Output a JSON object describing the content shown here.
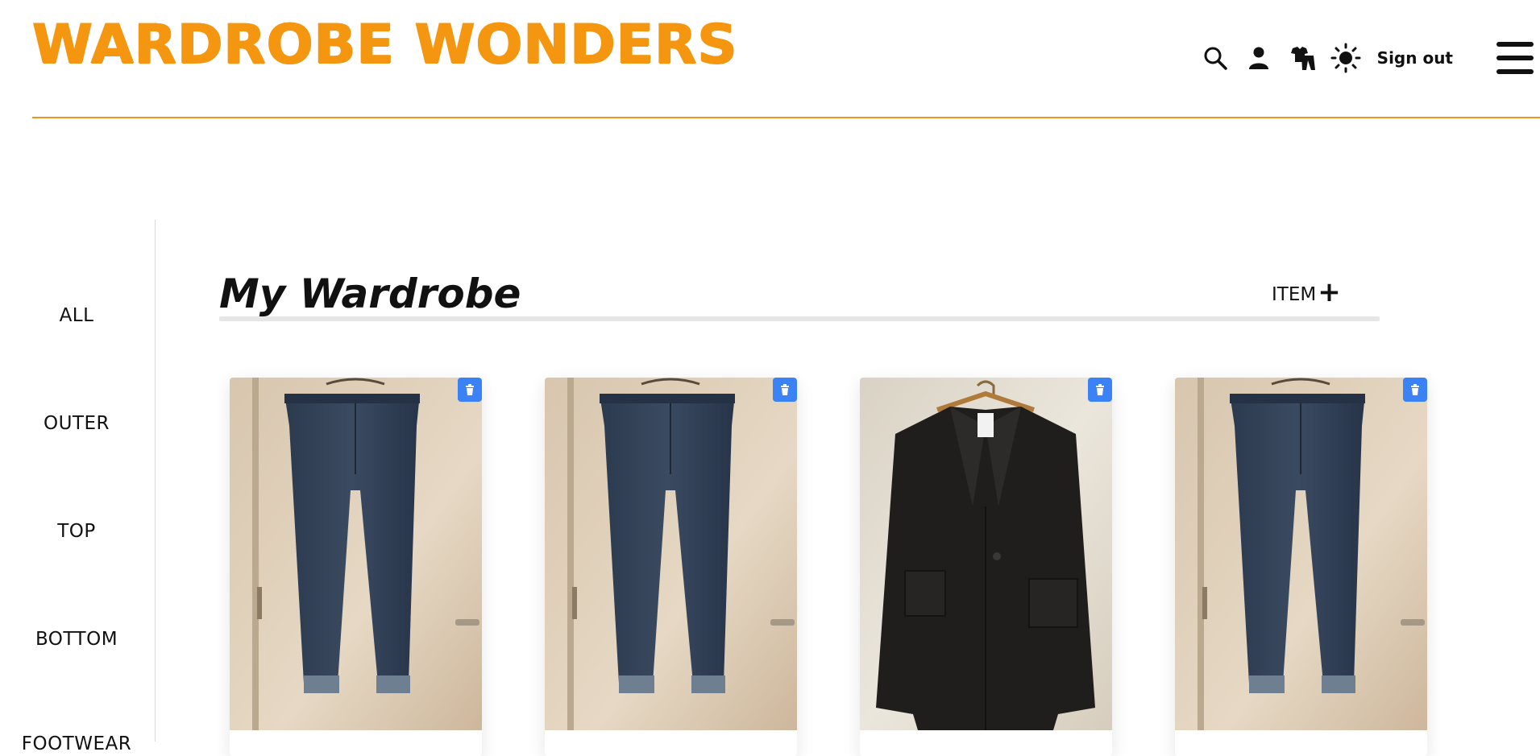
{
  "brand": {
    "name": "WARDROBE WONDERS",
    "color": "#f4960f"
  },
  "header": {
    "icons": [
      "search-icon",
      "user-icon",
      "outfit-icon",
      "theme-sun-icon"
    ],
    "signout_label": "Sign out",
    "menu_icon": "hamburger-icon"
  },
  "sidebar": {
    "items": [
      {
        "label": "ALL"
      },
      {
        "label": "OUTER"
      },
      {
        "label": "TOP"
      },
      {
        "label": "BOTTOM"
      },
      {
        "label": "FOOTWEAR"
      }
    ]
  },
  "main": {
    "title": "My Wardrobe",
    "add_item_label": "ITEM",
    "add_item_icon": "plus-icon"
  },
  "items": [
    {
      "type": "jeans",
      "delete_icon": "trash-icon"
    },
    {
      "type": "jeans",
      "delete_icon": "trash-icon"
    },
    {
      "type": "blazer",
      "delete_icon": "trash-icon"
    },
    {
      "type": "jeans",
      "delete_icon": "trash-icon"
    }
  ],
  "colors": {
    "accent": "#f4960f",
    "delete_button": "#3b82f6"
  }
}
